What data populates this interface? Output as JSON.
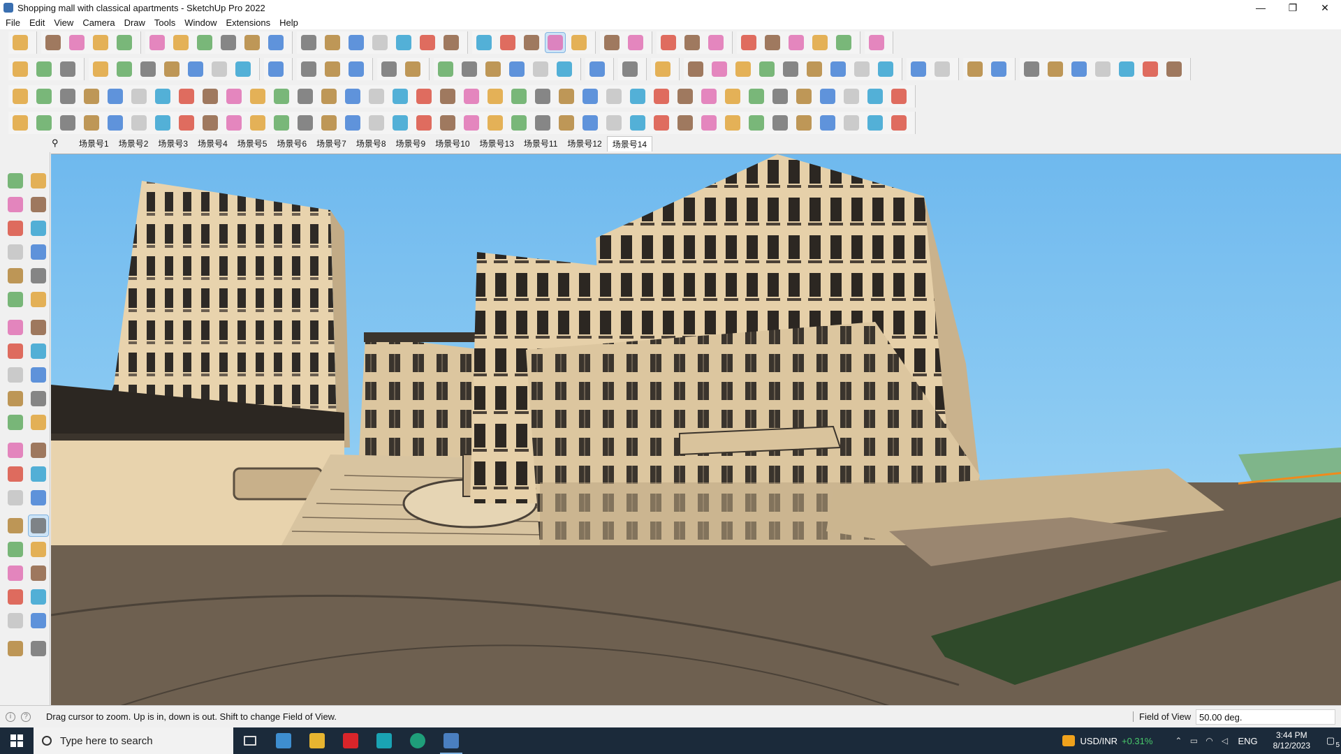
{
  "window": {
    "title": "Shopping mall with classical apartments - SketchUp Pro 2022",
    "controls": [
      "—",
      "❐",
      "✕"
    ]
  },
  "menu": [
    "File",
    "Edit",
    "View",
    "Camera",
    "Draw",
    "Tools",
    "Window",
    "Extensions",
    "Help"
  ],
  "scenes": {
    "items": [
      "场景号1",
      "场景号2",
      "场景号3",
      "场景号4",
      "场景号5",
      "场景号6",
      "场景号7",
      "场景号8",
      "场景号9",
      "场景号10",
      "场景号13",
      "场景号11",
      "场景号12",
      "场景号14"
    ],
    "active_index": 13
  },
  "status": {
    "hint": "Drag cursor to zoom.  Up is in, down is out. Shift to change Field of View.",
    "fov_label": "Field of View",
    "fov_value": "50.00 deg."
  },
  "taskbar": {
    "search_placeholder": "Type here to search",
    "stock_pair": "USD/INR",
    "stock_change": "+0.31%",
    "language": "ENG",
    "time": "3:44 PM",
    "date": "8/12/2023",
    "notification_count": "5"
  },
  "colors": {
    "sky": "#7fc3f0",
    "facade": "#e8d3ad",
    "trim": "#3b342c",
    "ground": "#6e6050",
    "grass": "#2f4a2a",
    "accent": "#3a6fb0"
  }
}
